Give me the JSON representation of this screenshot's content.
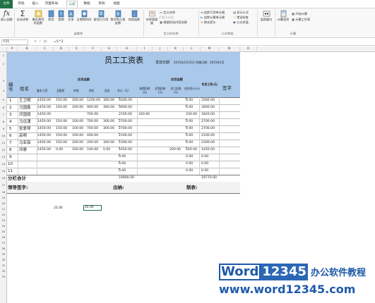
{
  "tabs": {
    "file": "文件",
    "home": "开始",
    "insert": "插入",
    "layout": "页面布局",
    "formulas": "公式",
    "data": "数据",
    "review": "审阅",
    "view": "视图"
  },
  "ribbon": {
    "insert_function": "插入函数",
    "autosum": "自动求和",
    "recent": "最近使用的函数",
    "financial": "财务",
    "logical": "逻辑",
    "text": "文本",
    "datetime": "日期和时间",
    "lookup": "查找与引用",
    "math": "数学和三角函数",
    "more": "其他函数",
    "group_library": "函数库",
    "name_manager": "名称管理器",
    "define_name": "定义名称",
    "use_in_formula": "用于公式",
    "create_from_selection": "根据所选内容创建",
    "group_names": "定义的名称",
    "trace_precedents": "追踪引用单元格",
    "trace_dependents": "追踪从属单元格",
    "remove_arrows": "移去箭头",
    "show_formulas": "显示公式",
    "error_checking": "错误检查",
    "evaluate": "公式求值",
    "group_audit": "公式审核",
    "watch": "监视窗口",
    "calc_options": "计算选项",
    "calc_now": "开始计算",
    "calc_sheet": "计算工作表",
    "group_calc": "计算"
  },
  "formula_bar": {
    "name_box": "F21",
    "fx": "fx",
    "formula": "=5^2"
  },
  "columns": [
    "A",
    "B",
    "C",
    "D",
    "E",
    "F",
    "G",
    "H",
    "I",
    "J",
    "K",
    "L",
    "M",
    "N",
    "O"
  ],
  "rows": [
    "1",
    "2",
    "3",
    "4",
    "5",
    "6",
    "7",
    "8",
    "9",
    "10",
    "11",
    "12",
    "13",
    "14",
    "15",
    "16",
    "17",
    "18",
    "19",
    "20",
    "21",
    "22",
    "23",
    "24",
    "25",
    "26",
    "27",
    "28",
    "29",
    "30",
    "31",
    "32",
    "33"
  ],
  "sheet": {
    "title": "员工工资表",
    "issue_label": "发放日期",
    "issue_date": "2015年2月10日 所属日期：2015年1月",
    "hdr_no": "编号",
    "hdr_name": "姓名",
    "hdr_payable": "应发金额",
    "hdr_deduct": "应扣金额",
    "hdr_sign": "签字",
    "sub": [
      "基本工资",
      "全勤奖",
      "补助",
      "岗位",
      "奖金",
      "合计（元）",
      "病假扣款(元)",
      "迟到扣款(元)",
      "员工扣款(元)",
      "应扣合计(元)",
      "实发工资(元)"
    ],
    "rows": [
      {
        "no": "1",
        "name": "王卫明",
        "c": [
          "1450.00",
          "150.00",
          "200.00",
          "1200.00",
          "300.00",
          "3300.00",
          "",
          "",
          "",
          "0.00",
          "3300.00"
        ]
      },
      {
        "no": "2",
        "name": "马国鑫",
        "c": [
          "1450.00",
          "150.00",
          "200.00",
          "900.00",
          "300.00",
          "3000.00",
          "",
          "",
          "",
          "0.00",
          "3000.00"
        ]
      },
      {
        "no": "3",
        "name": "邓国斌",
        "c": [
          "1450.00",
          "",
          "",
          "700.00",
          "",
          "2150.00",
          "330.00",
          "",
          "",
          "330.00",
          "1820.00"
        ]
      },
      {
        "no": "4",
        "name": "马远涌",
        "c": [
          "1450.00",
          "150.00",
          "100.00",
          "700.00",
          "300.00",
          "2700.00",
          "",
          "",
          "",
          "0.00",
          "2700.00"
        ]
      },
      {
        "no": "5",
        "name": "张爱琴",
        "c": [
          "1450.00",
          "150.00",
          "100.00",
          "700.00",
          "300.00",
          "2700.00",
          "",
          "",
          "",
          "0.00",
          "2700.00"
        ]
      },
      {
        "no": "6",
        "name": "高明",
        "c": [
          "1450.00",
          "150.00",
          "100.00",
          "400.00",
          "",
          "2100.00",
          "",
          "",
          "",
          "0.00",
          "2100.00"
        ]
      },
      {
        "no": "7",
        "name": "马亚茹",
        "c": [
          "1450.00",
          "150.00",
          "200.00",
          "200.00",
          "300.00",
          "2300.00",
          "",
          "",
          "",
          "0.00",
          "2300.00"
        ]
      },
      {
        "no": "8",
        "name": "邓睿",
        "c": [
          "1450.00",
          "0.00",
          "100.00",
          "100.00",
          "0.00",
          "1650.00",
          "",
          "",
          "200.00",
          "200.00",
          "1450.00"
        ]
      },
      {
        "no": "9",
        "name": "",
        "c": [
          "",
          "",
          "",
          "",
          "",
          "0.00",
          "",
          "",
          "",
          "0.00",
          "0.00"
        ]
      },
      {
        "no": "10",
        "name": "",
        "c": [
          "",
          "",
          "",
          "",
          "",
          "0.00",
          "",
          "",
          "",
          "0.00",
          "0.00"
        ]
      },
      {
        "no": "11",
        "name": "",
        "c": [
          "",
          "",
          "",
          "",
          "",
          "0.00",
          "",
          "",
          "",
          "0.00",
          "0.00"
        ]
      }
    ],
    "subtotal_label": "分栏合计",
    "subtotal_total": "19900.00",
    "subtotal_net": "19770.00",
    "leader_sign": "领导签字:",
    "cashier": "出纳:",
    "preparer": "制表:",
    "r21_d": "25.00",
    "r21_f": "25.00"
  },
  "watermark": {
    "brand_word": "Word",
    "brand_num": "12345",
    "brand_cn": "办公软件教程",
    "url": "www.word12345.com"
  }
}
